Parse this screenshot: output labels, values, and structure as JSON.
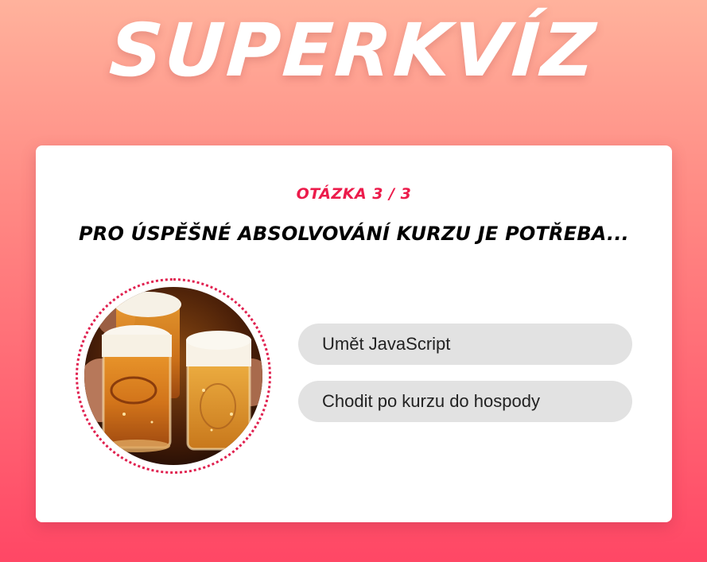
{
  "app": {
    "logo_text": "SUPERKVÍZ"
  },
  "quiz": {
    "counter": "OTÁZKA 3 / 3",
    "question": "PRO ÚSPĚŠNÉ ABSOLVOVÁNÍ KURZU JE POTŘEBA...",
    "image_icon": "beer-mugs-photo",
    "answers": [
      {
        "label": "Umět JavaScript"
      },
      {
        "label": "Chodit po kurzu do hospody"
      }
    ]
  },
  "colors": {
    "accent": "#ec1b4b",
    "background_top": "#ffb29c",
    "background_bottom": "#ff4765",
    "answer_bg": "#e2e2e2"
  }
}
